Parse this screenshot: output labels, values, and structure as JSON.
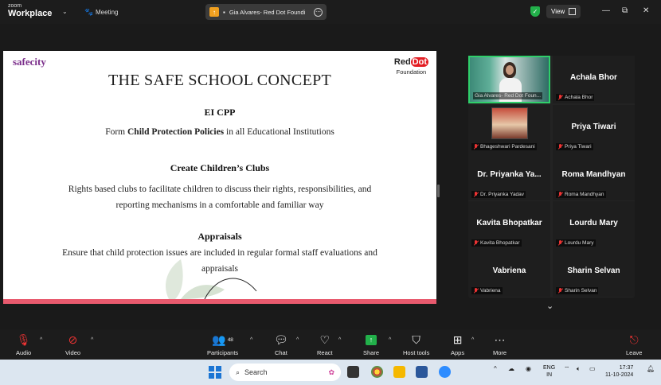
{
  "titlebar": {
    "brand_line1": "zoom",
    "brand_line2": "Workplace",
    "meeting_label": "Meeting",
    "share_chip_name": "Gia Alvares- Red Dot Foundi",
    "view_label": "View"
  },
  "slide": {
    "logo_left": "safecity",
    "logo_right_a": "Red",
    "logo_right_b": "Dot",
    "logo_right_c": "Foundation",
    "title": "THE SAFE SCHOOL CONCEPT",
    "sections": [
      {
        "heading": "EI CPP",
        "text_pre": "Form ",
        "text_bold": "Child Protection Policies",
        "text_post": " in all Educational Institutions"
      },
      {
        "heading": "Create Children’s Clubs",
        "line1": "Rights based clubs to facilitate children to discuss their rights, responsibilities, and",
        "line2": "reporting mechanisms in a comfortable and familiar way"
      },
      {
        "heading": "Appraisals",
        "line1": "Ensure that child protection issues are included in regular formal staff evaluations and",
        "line2": "appraisals"
      }
    ]
  },
  "gallery": [
    {
      "name": "",
      "label": "Gia Alvares- Red Dot Foun...",
      "video": true,
      "active": true
    },
    {
      "name": "Achala Bhor",
      "label": "Achala Bhor"
    },
    {
      "name": "",
      "label": "Bhageshwari Pardesani",
      "thumb": true
    },
    {
      "name": "Priya Tiwari",
      "label": "Priya Tiwari"
    },
    {
      "name": "Dr. Priyanka Ya...",
      "label": "Dr. Priyanka Yadav"
    },
    {
      "name": "Roma Mandhyan",
      "label": "Roma Mandhyan"
    },
    {
      "name": "Kavita Bhopatkar",
      "label": "Kavita Bhopatkar"
    },
    {
      "name": "Lourdu Mary",
      "label": "Lourdu Mary"
    },
    {
      "name": "Vabriena",
      "label": "Vabriena"
    },
    {
      "name": "Sharin Selvan",
      "label": "Sharin Selvan"
    }
  ],
  "toolbar": {
    "audio": "Audio",
    "video": "Video",
    "participants": "Participants",
    "participants_count": "48",
    "chat": "Chat",
    "react": "React",
    "share": "Share",
    "host_tools": "Host tools",
    "apps": "Apps",
    "more": "More",
    "leave": "Leave"
  },
  "taskbar": {
    "search_placeholder": "Search",
    "lang1": "ENG",
    "lang2": "IN",
    "time": "17:37",
    "date": "11-10-2024"
  },
  "colors": {
    "accent_green": "#2fcf6a",
    "slide_bottom_bar": "#e85a6e",
    "red_dot": "#e31e24",
    "mute_red": "#e33333"
  }
}
